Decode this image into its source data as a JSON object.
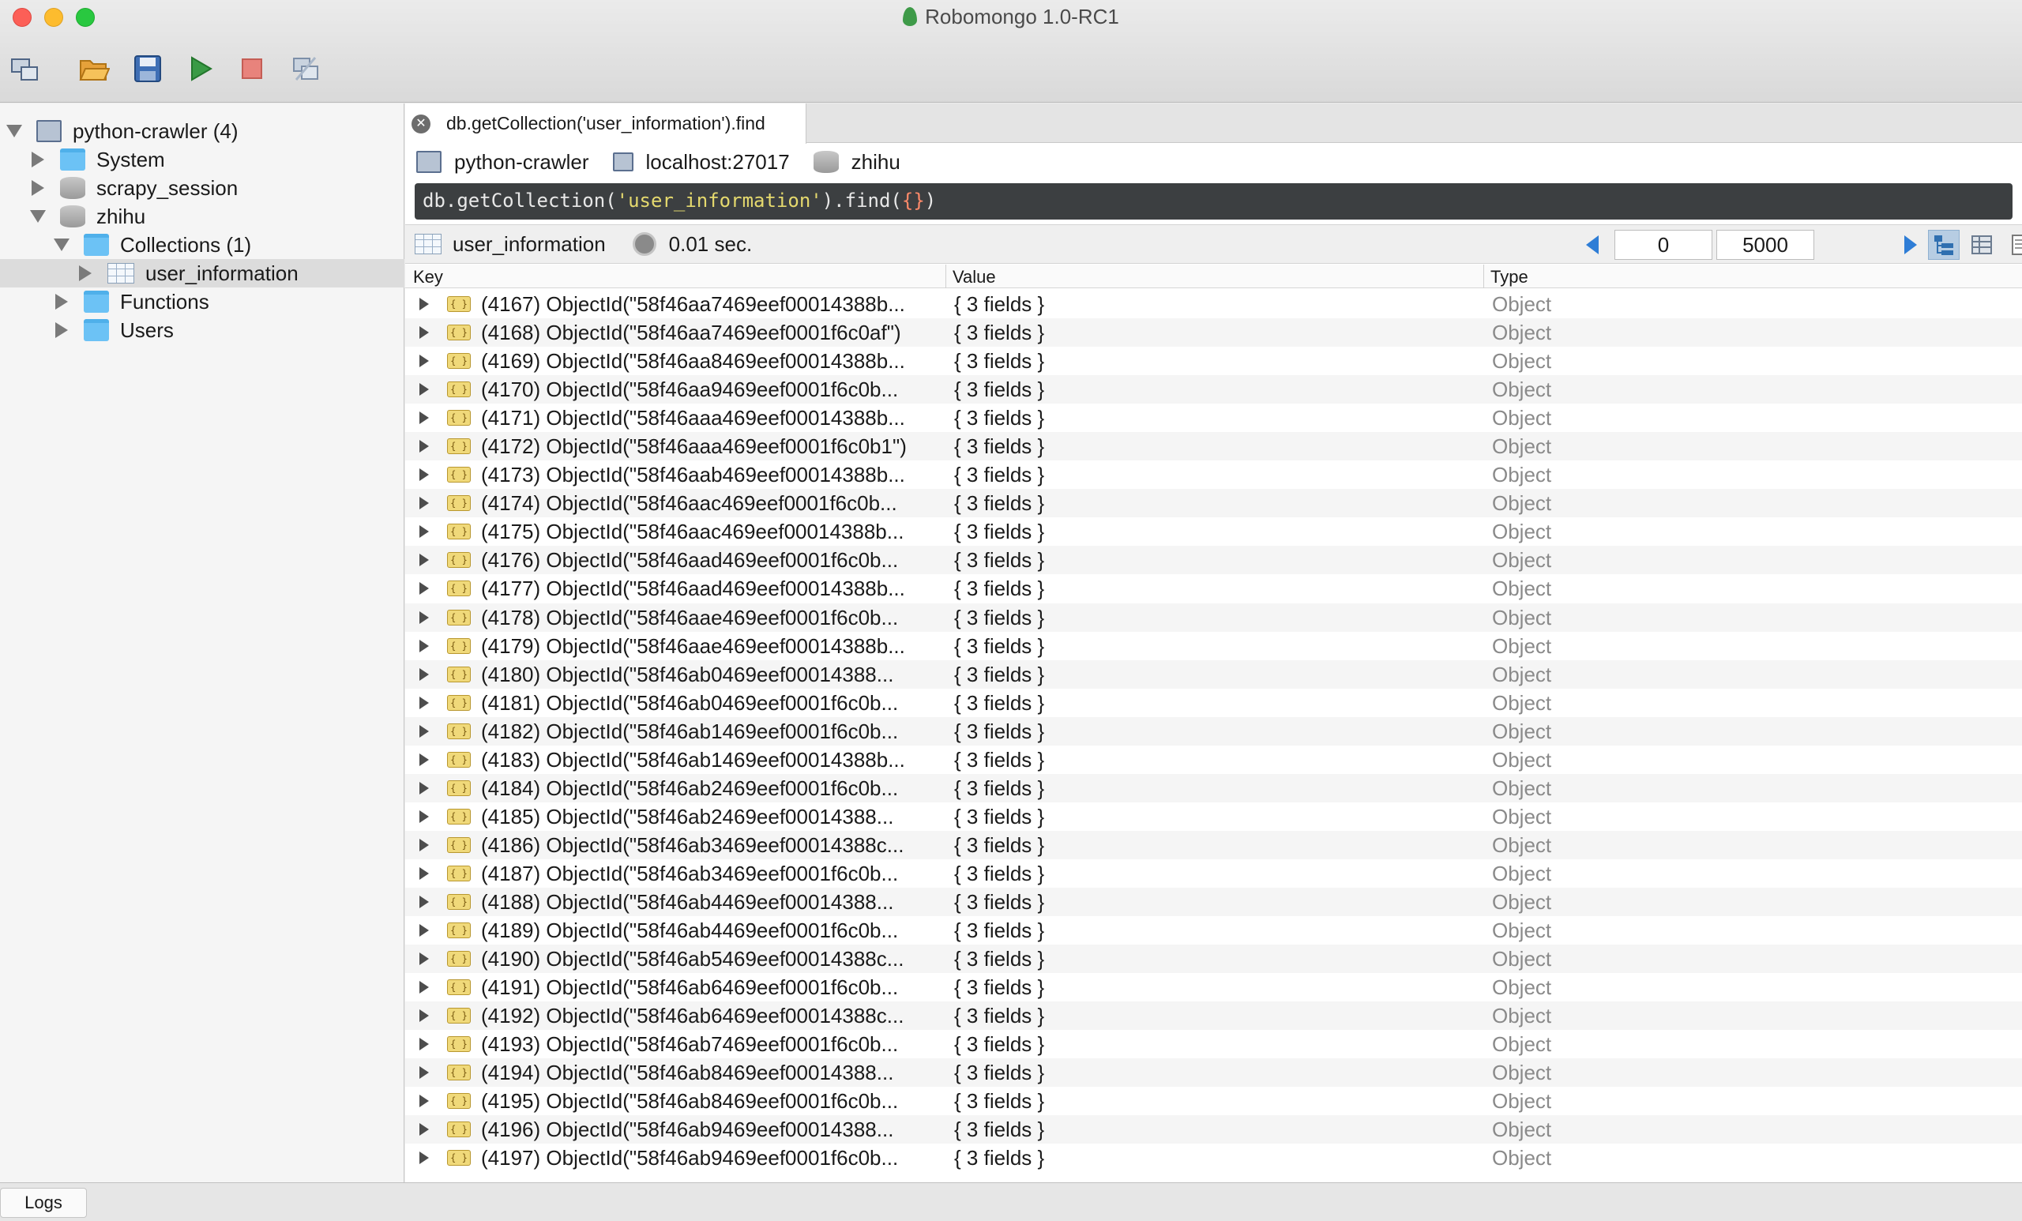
{
  "window": {
    "title": "Robomongo 1.0-RC1"
  },
  "toolbar": {
    "buttons": [
      "connect-icon",
      "open-icon",
      "save-icon",
      "execute-icon",
      "stop-icon",
      "refresh-icon"
    ]
  },
  "sidebar": {
    "tree": [
      {
        "label": "python-crawler (4)",
        "icon": "server-icon",
        "expanded": true
      },
      {
        "label": "System",
        "icon": "folder-icon",
        "expanded": false
      },
      {
        "label": "scrapy_session",
        "icon": "database-icon",
        "expanded": false
      },
      {
        "label": "zhihu",
        "icon": "database-icon",
        "expanded": true
      },
      {
        "label": "Collections (1)",
        "icon": "folder-icon",
        "expanded": true
      },
      {
        "label": "user_information",
        "icon": "collection-icon",
        "expanded": false,
        "selected": true
      },
      {
        "label": "Functions",
        "icon": "folder-icon",
        "expanded": false
      },
      {
        "label": "Users",
        "icon": "folder-icon",
        "expanded": false
      }
    ]
  },
  "tab": {
    "label": "db.getCollection('user_information').find"
  },
  "connection": {
    "server": "python-crawler",
    "host": "localhost:27017",
    "database": "zhihu"
  },
  "query": {
    "prefix": "db.getCollection(",
    "collection": "'user_information'",
    "middle": ").find(",
    "arg": "{}",
    "suffix": ")"
  },
  "results": {
    "collection": "user_information",
    "time": "0.01 sec.",
    "skip": "0",
    "limit": "5000",
    "columns": {
      "key": "Key",
      "value": "Value",
      "type": "Type"
    },
    "rows": [
      {
        "key": "(4167) ObjectId(\"58f46aa7469eef00014388b...",
        "value": "{ 3 fields }",
        "type": "Object"
      },
      {
        "key": "(4168) ObjectId(\"58f46aa7469eef0001f6c0af\")",
        "value": "{ 3 fields }",
        "type": "Object"
      },
      {
        "key": "(4169) ObjectId(\"58f46aa8469eef00014388b...",
        "value": "{ 3 fields }",
        "type": "Object"
      },
      {
        "key": "(4170) ObjectId(\"58f46aa9469eef0001f6c0b...",
        "value": "{ 3 fields }",
        "type": "Object"
      },
      {
        "key": "(4171) ObjectId(\"58f46aaa469eef00014388b...",
        "value": "{ 3 fields }",
        "type": "Object"
      },
      {
        "key": "(4172) ObjectId(\"58f46aaa469eef0001f6c0b1\")",
        "value": "{ 3 fields }",
        "type": "Object"
      },
      {
        "key": "(4173) ObjectId(\"58f46aab469eef00014388b...",
        "value": "{ 3 fields }",
        "type": "Object"
      },
      {
        "key": "(4174) ObjectId(\"58f46aac469eef0001f6c0b...",
        "value": "{ 3 fields }",
        "type": "Object"
      },
      {
        "key": "(4175) ObjectId(\"58f46aac469eef00014388b...",
        "value": "{ 3 fields }",
        "type": "Object"
      },
      {
        "key": "(4176) ObjectId(\"58f46aad469eef0001f6c0b...",
        "value": "{ 3 fields }",
        "type": "Object"
      },
      {
        "key": "(4177) ObjectId(\"58f46aad469eef00014388b...",
        "value": "{ 3 fields }",
        "type": "Object"
      },
      {
        "key": "(4178) ObjectId(\"58f46aae469eef0001f6c0b...",
        "value": "{ 3 fields }",
        "type": "Object"
      },
      {
        "key": "(4179) ObjectId(\"58f46aae469eef00014388b...",
        "value": "{ 3 fields }",
        "type": "Object"
      },
      {
        "key": "(4180) ObjectId(\"58f46ab0469eef00014388...",
        "value": "{ 3 fields }",
        "type": "Object"
      },
      {
        "key": "(4181) ObjectId(\"58f46ab0469eef0001f6c0b...",
        "value": "{ 3 fields }",
        "type": "Object"
      },
      {
        "key": "(4182) ObjectId(\"58f46ab1469eef0001f6c0b...",
        "value": "{ 3 fields }",
        "type": "Object"
      },
      {
        "key": "(4183) ObjectId(\"58f46ab1469eef00014388b...",
        "value": "{ 3 fields }",
        "type": "Object"
      },
      {
        "key": "(4184) ObjectId(\"58f46ab2469eef0001f6c0b...",
        "value": "{ 3 fields }",
        "type": "Object"
      },
      {
        "key": "(4185) ObjectId(\"58f46ab2469eef00014388...",
        "value": "{ 3 fields }",
        "type": "Object"
      },
      {
        "key": "(4186) ObjectId(\"58f46ab3469eef00014388c...",
        "value": "{ 3 fields }",
        "type": "Object"
      },
      {
        "key": "(4187) ObjectId(\"58f46ab3469eef0001f6c0b...",
        "value": "{ 3 fields }",
        "type": "Object"
      },
      {
        "key": "(4188) ObjectId(\"58f46ab4469eef00014388...",
        "value": "{ 3 fields }",
        "type": "Object"
      },
      {
        "key": "(4189) ObjectId(\"58f46ab4469eef0001f6c0b...",
        "value": "{ 3 fields }",
        "type": "Object"
      },
      {
        "key": "(4190) ObjectId(\"58f46ab5469eef00014388c...",
        "value": "{ 3 fields }",
        "type": "Object"
      },
      {
        "key": "(4191) ObjectId(\"58f46ab6469eef0001f6c0b...",
        "value": "{ 3 fields }",
        "type": "Object"
      },
      {
        "key": "(4192) ObjectId(\"58f46ab6469eef00014388c...",
        "value": "{ 3 fields }",
        "type": "Object"
      },
      {
        "key": "(4193) ObjectId(\"58f46ab7469eef0001f6c0b...",
        "value": "{ 3 fields }",
        "type": "Object"
      },
      {
        "key": "(4194) ObjectId(\"58f46ab8469eef00014388...",
        "value": "{ 3 fields }",
        "type": "Object"
      },
      {
        "key": "(4195) ObjectId(\"58f46ab8469eef0001f6c0b...",
        "value": "{ 3 fields }",
        "type": "Object"
      },
      {
        "key": "(4196) ObjectId(\"58f46ab9469eef00014388...",
        "value": "{ 3 fields }",
        "type": "Object"
      },
      {
        "key": "(4197) ObjectId(\"58f46ab9469eef0001f6c0b...",
        "value": "{ 3 fields }",
        "type": "Object"
      }
    ]
  },
  "footer": {
    "logs_label": "Logs"
  }
}
